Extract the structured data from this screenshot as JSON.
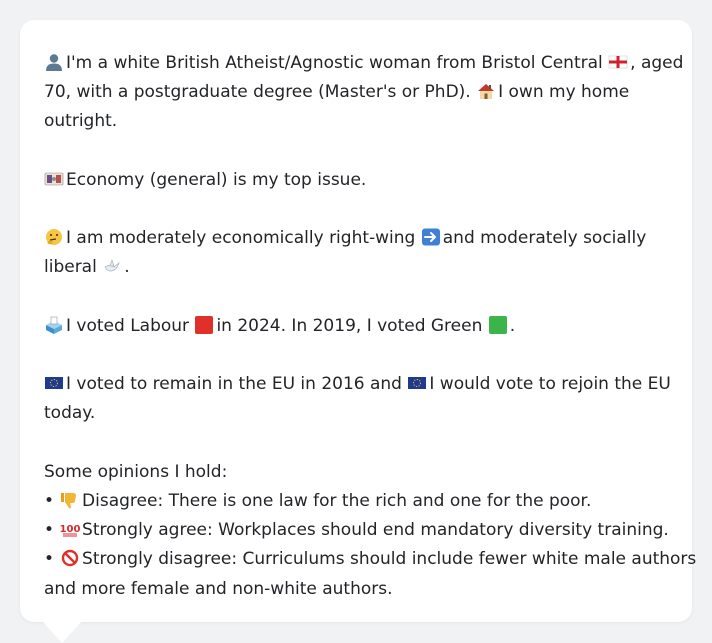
{
  "profile": {
    "line1_a": "I'm a white British Atheist/Agnostic woman from Bristol Central",
    "line1_b": ", aged",
    "line2_a": "70, with a postgraduate degree (Master's or PhD).",
    "line2_b": "I own my home",
    "line3": "outright."
  },
  "issue": {
    "text": "Economy (general) is my top issue."
  },
  "ideology": {
    "line1_a": "I am moderately economically right-wing",
    "line1_b": "and moderately socially",
    "line2": "liberal",
    "line2_end": "."
  },
  "votes": {
    "a": "I voted Labour",
    "b": "in 2024. In 2019, I voted Green",
    "c": "."
  },
  "eu": {
    "line1_a": "I voted to remain in the EU in 2016 and",
    "line1_b": "I would vote to rejoin the EU",
    "line2": "today."
  },
  "opinions": {
    "heading": "Some opinions I hold:",
    "bullet": "•",
    "items": [
      {
        "icon": "thumbs-down-icon",
        "text": "Disagree: There is one law for the rich and one for the poor."
      },
      {
        "icon": "hundred-points-icon",
        "text": "Strongly agree: Workplaces should end mandatory diversity training."
      },
      {
        "icon": "prohibited-icon",
        "text_line1": "Strongly disagree: Curriculums should include fewer white male authors",
        "text_line2": "and more female and non-white authors."
      }
    ]
  },
  "colors": {
    "labour": "#e0302a",
    "green": "#3bb54a",
    "eu_blue": "#1f3a93",
    "eu_star": "#f5d000",
    "text": "#222428",
    "background": "#f1f2f4"
  }
}
